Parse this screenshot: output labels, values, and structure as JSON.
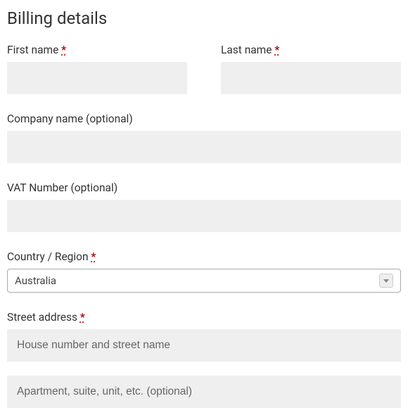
{
  "heading": "Billing details",
  "required_marker": "*",
  "fields": {
    "first_name": {
      "label": "First name",
      "required": true,
      "value": ""
    },
    "last_name": {
      "label": "Last name",
      "required": true,
      "value": ""
    },
    "company": {
      "label": "Company name (optional)",
      "required": false,
      "value": ""
    },
    "vat": {
      "label": "VAT Number (optional)",
      "required": false,
      "value": ""
    },
    "country": {
      "label": "Country / Region",
      "required": true,
      "value": "Australia"
    },
    "street": {
      "label": "Street address",
      "required": true,
      "placeholder1": "House number and street name",
      "placeholder2": "Apartment, suite, unit, etc. (optional)"
    }
  }
}
